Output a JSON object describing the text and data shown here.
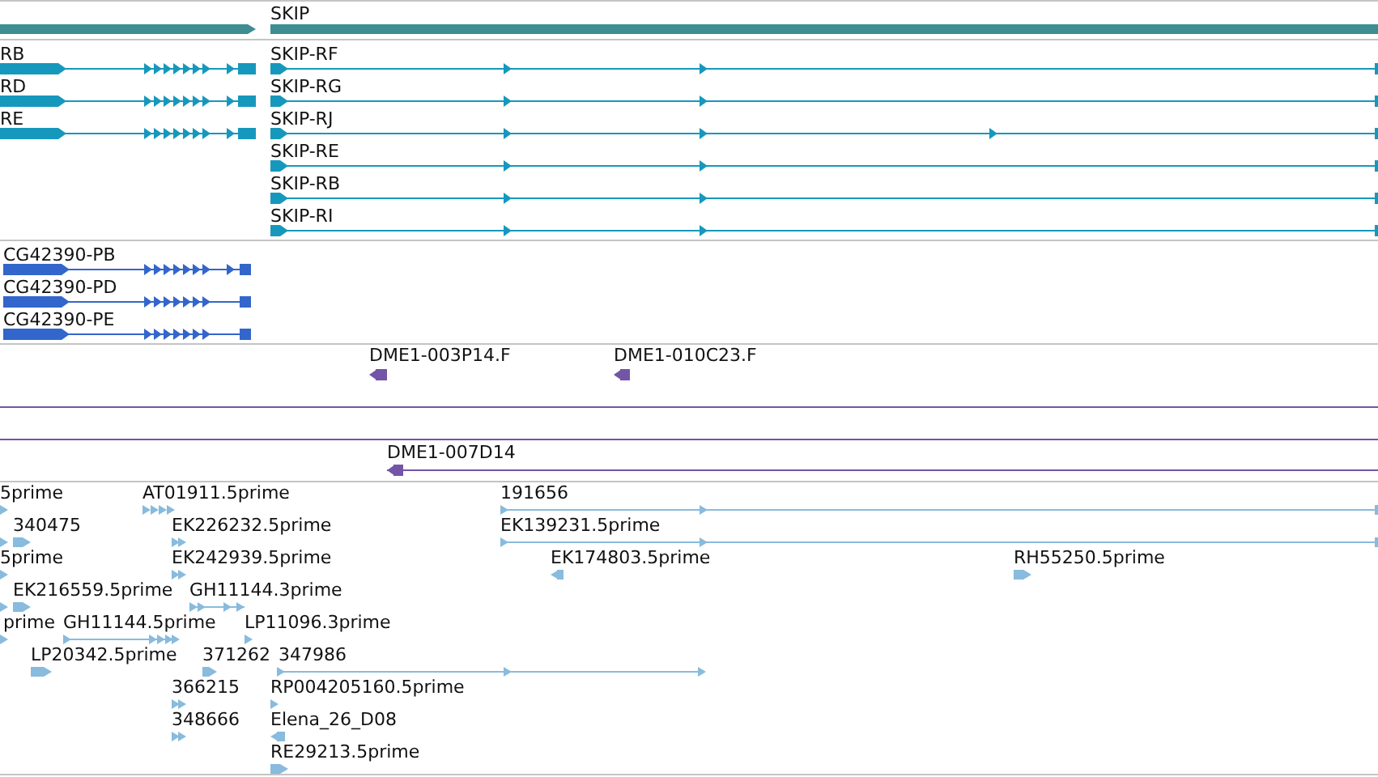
{
  "tracks": [
    {
      "color": "#3d8d92",
      "features": [
        {
          "label": "SKIP"
        }
      ]
    },
    {
      "color": "#1698bd",
      "features": [
        {
          "label": "RB"
        },
        {
          "label": "RD"
        },
        {
          "label": "RE"
        },
        {
          "label": "SKIP-RF"
        },
        {
          "label": "SKIP-RG"
        },
        {
          "label": "SKIP-RJ"
        },
        {
          "label": "SKIP-RE"
        },
        {
          "label": "SKIP-RB"
        },
        {
          "label": "SKIP-RI"
        }
      ]
    },
    {
      "color": "#3366cc",
      "features": [
        {
          "label": "CG42390-PB"
        },
        {
          "label": "CG42390-PD"
        },
        {
          "label": "CG42390-PE"
        }
      ]
    },
    {
      "color": "#7355a8",
      "features": [
        {
          "label": "DME1-003P14.F"
        },
        {
          "label": "DME1-010C23.F"
        },
        {
          "label": "DME1-007D14"
        }
      ]
    },
    {
      "color": "#88bbdd",
      "features": [
        {
          "label": "5prime"
        },
        {
          "label": "AT01911.5prime"
        },
        {
          "label": "191656"
        },
        {
          "label": "340475"
        },
        {
          "label": "EK226232.5prime"
        },
        {
          "label": "EK139231.5prime"
        },
        {
          "label": "5prime"
        },
        {
          "label": "EK242939.5prime"
        },
        {
          "label": "EK174803.5prime"
        },
        {
          "label": "RH55250.5prime"
        },
        {
          "label": "EK216559.5prime"
        },
        {
          "label": "GH11144.3prime"
        },
        {
          "label": "prime"
        },
        {
          "label": "GH11144.5prime"
        },
        {
          "label": "LP11096.3prime"
        },
        {
          "label": "LP20342.5prime"
        },
        {
          "label": "371262"
        },
        {
          "label": "347986"
        },
        {
          "label": "366215"
        },
        {
          "label": "RP004205160.5prime"
        },
        {
          "label": "348666"
        },
        {
          "label": "Elena_26_D08"
        },
        {
          "label": "RE29213.5prime"
        }
      ]
    }
  ]
}
